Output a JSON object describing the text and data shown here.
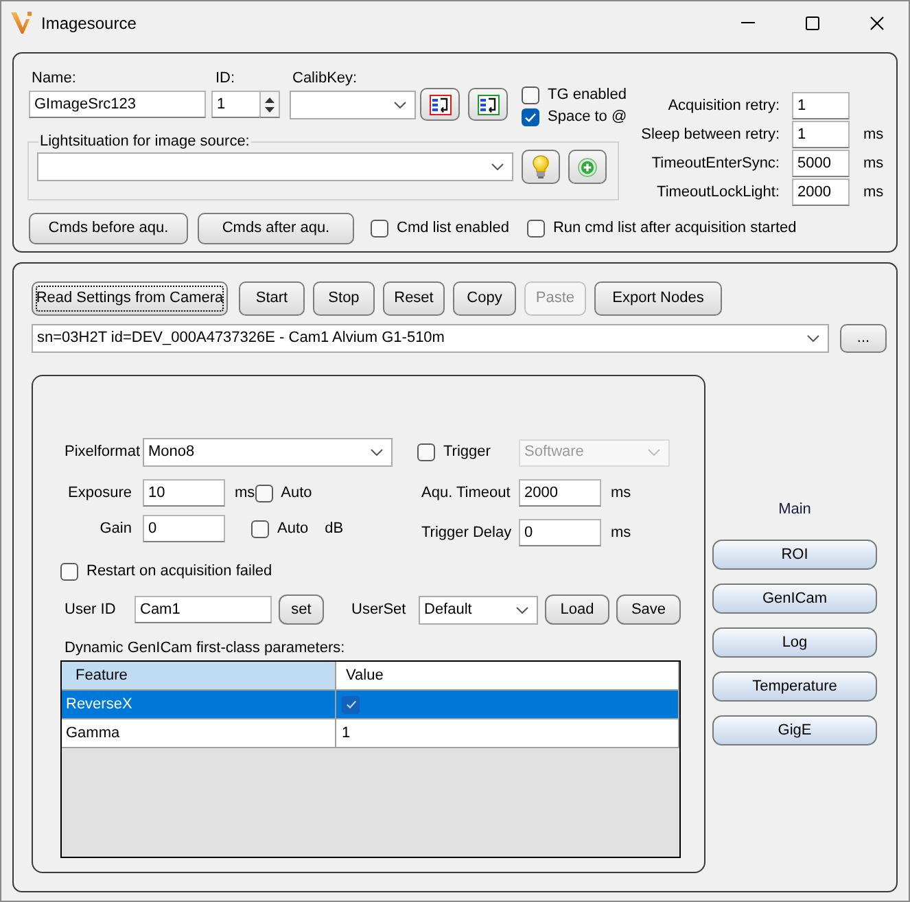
{
  "window": {
    "title": "Imagesource"
  },
  "source": {
    "name": {
      "label": "Name:",
      "value": "GImageSrc123"
    },
    "id": {
      "label": "ID:",
      "value": "1"
    },
    "calib_key": {
      "label": "CalibKey:"
    },
    "options": [
      {
        "label": "TG enabled",
        "checked": false
      },
      {
        "label": "Space to @",
        "checked": true
      }
    ],
    "lightsituation": {
      "label": "Lightsituation for image source:"
    },
    "cmd_buttons": [
      "Cmds before aqu.",
      "Cmds after aqu."
    ],
    "cmd_options": [
      {
        "label": "Cmd list enabled",
        "checked": false
      },
      {
        "label": "Run cmd list after acquisition started",
        "checked": false
      }
    ],
    "timing": [
      {
        "label": "Acquisition retry:",
        "value": "1"
      },
      {
        "label": "Sleep between retry:",
        "value": "1",
        "unit": "ms"
      },
      {
        "label": "TimeoutEnterSync:",
        "value": "5000",
        "unit": "ms"
      },
      {
        "label": "TimeoutLockLight:",
        "value": "2000",
        "unit": "ms"
      }
    ]
  },
  "camera": {
    "toolbar": [
      {
        "label": "Read Settings from Camera",
        "focused": true,
        "disabled": false
      },
      {
        "label": "Start",
        "focused": false,
        "disabled": false
      },
      {
        "label": "Stop",
        "focused": false,
        "disabled": false
      },
      {
        "label": "Reset",
        "focused": false,
        "disabled": false
      },
      {
        "label": "Copy",
        "focused": false,
        "disabled": false
      },
      {
        "label": "Paste",
        "focused": false,
        "disabled": true
      },
      {
        "label": "Export Nodes",
        "focused": false,
        "disabled": false
      }
    ],
    "device": {
      "value": "sn=03H2T id=DEV_000A4737326E - Cam1 Alvium G1-510m",
      "button": "..."
    },
    "settings": {
      "pixelformat": {
        "label": "Pixelformat",
        "value": "Mono8"
      },
      "trigger": {
        "label": "Trigger",
        "checked": false,
        "mode": "Software",
        "mode_disabled": true
      },
      "exposure": {
        "label": "Exposure",
        "value": "10",
        "unit": "ms",
        "auto_label": "Auto",
        "auto": false
      },
      "gain": {
        "label": "Gain",
        "value": "0",
        "unit": "dB",
        "auto_label": "Auto",
        "auto": false
      },
      "aqu_timeout": {
        "label": "Aqu. Timeout",
        "value": "2000",
        "unit": "ms"
      },
      "trigger_delay": {
        "label": "Trigger Delay",
        "value": "0",
        "unit": "ms"
      },
      "restart": {
        "label": "Restart on acquisition failed",
        "checked": false
      },
      "user_id": {
        "label": "User ID",
        "value": "Cam1",
        "button": "set"
      },
      "user_set": {
        "label": "UserSet",
        "value": "Default",
        "buttons": [
          "Load",
          "Save"
        ]
      }
    },
    "parameters": {
      "title": "Dynamic GenICam first-class parameters:",
      "columns": [
        {
          "label": "Feature",
          "highlighted": true
        },
        {
          "label": "Value",
          "highlighted": false
        }
      ],
      "rows": [
        {
          "feature": "ReverseX",
          "kind": "checkbox",
          "checked": true,
          "selected": true
        },
        {
          "feature": "Gamma",
          "kind": "text",
          "value": "1",
          "selected": false
        }
      ]
    },
    "pages": {
      "title": "Main",
      "buttons": [
        "ROI",
        "GenICam",
        "Log",
        "Temperature",
        "GigE"
      ]
    }
  }
}
